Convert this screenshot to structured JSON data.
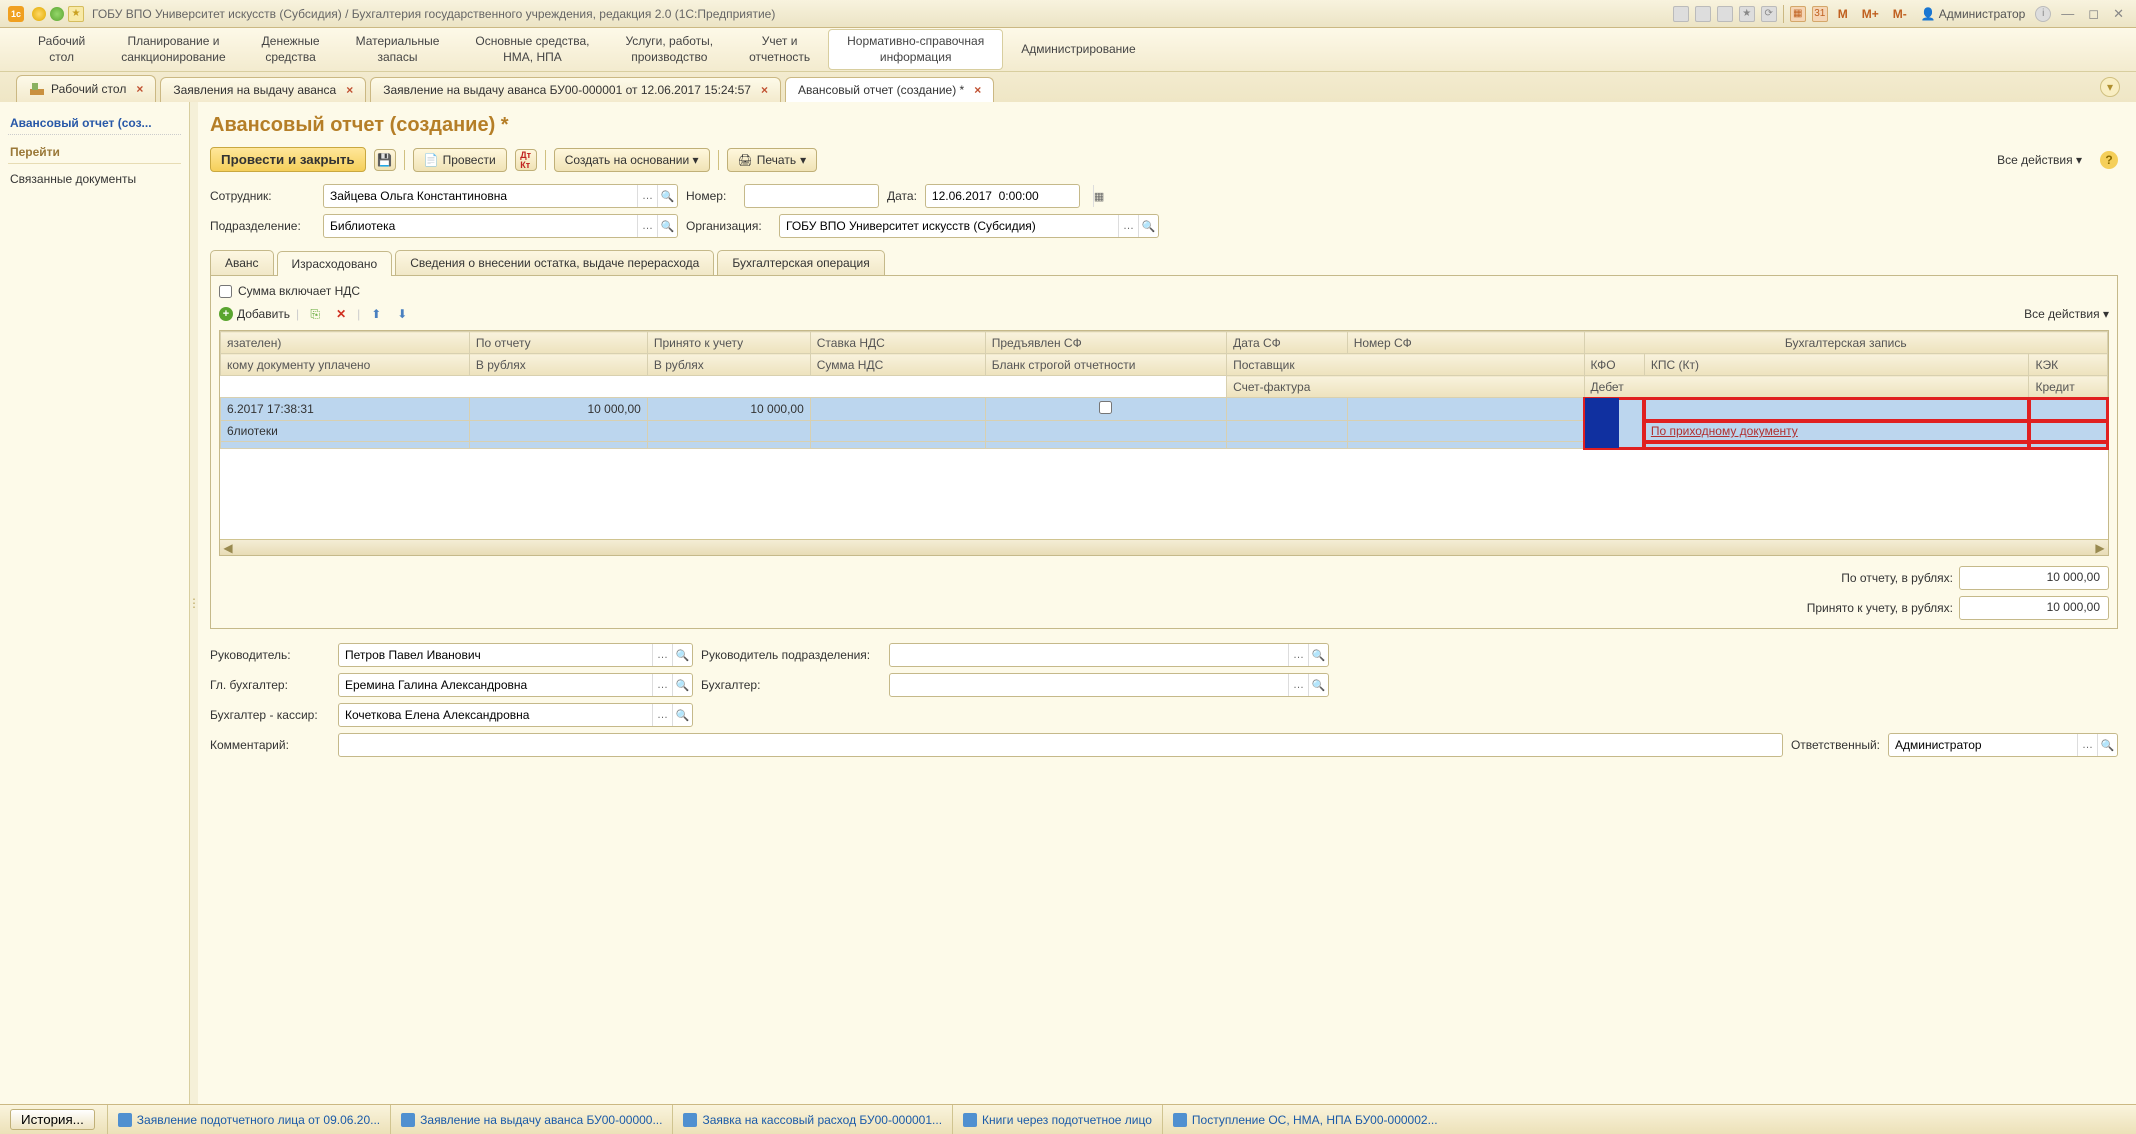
{
  "titlebar": {
    "title": "ГОБУ ВПО Университет искусств (Субсидия) / Бухгалтерия государственного учреждения, редакция 2.0  (1С:Предприятие)",
    "m": "M",
    "mplus": "M+",
    "mminus": "M-",
    "user": "Администратор"
  },
  "mainmenu": [
    "Рабочий\nстол",
    "Планирование и\nсанкционирование",
    "Денежные\nсредства",
    "Материальные\nзапасы",
    "Основные средства,\nНМА, НПА",
    "Услуги, работы,\nпроизводство",
    "Учет и\nотчетность",
    "Нормативно-справочная\nинформация",
    "Администрирование"
  ],
  "doctabs": [
    {
      "label": "Рабочий стол"
    },
    {
      "label": "Заявления на выдачу аванса"
    },
    {
      "label": "Заявление на выдачу аванса БУ00-000001 от 12.06.2017 15:24:57"
    },
    {
      "label": "Авансовый отчет (создание) *",
      "active": true
    }
  ],
  "sidebar": {
    "header": "Авансовый отчет (соз...",
    "group": "Перейти",
    "link1": "Связанные документы"
  },
  "page_title": "Авансовый отчет (создание) *",
  "toolbar": {
    "post_close": "Провести и закрыть",
    "post": "Провести",
    "create_based": "Создать на основании",
    "print": "Печать",
    "all_actions": "Все действия"
  },
  "form": {
    "employee_lbl": "Сотрудник:",
    "employee_val": "Зайцева Ольга Константиновна",
    "number_lbl": "Номер:",
    "number_val": "",
    "date_lbl": "Дата:",
    "date_val": "12.06.2017  0:00:00",
    "dept_lbl": "Подразделение:",
    "dept_val": "Библиотека",
    "org_lbl": "Организация:",
    "org_val": "ГОБУ ВПО Университет искусств (Субсидия)"
  },
  "subtabs": [
    "Аванс",
    "Израсходовано",
    "Сведения о внесении остатка, выдаче перерасхода",
    "Бухгалтерская операция"
  ],
  "subtab_active": 1,
  "vat_checkbox": "Сумма включает НДС",
  "grid_tb": {
    "add": "Добавить",
    "all_actions": "Все действия"
  },
  "grid_headers": {
    "r1": [
      "язателен)",
      "По отчету",
      "Принято к учету",
      "Ставка НДС",
      "Предъявлен СФ",
      "Дата СФ",
      "Номер СФ",
      "Бухгалтерская запись"
    ],
    "r2": [
      "кому документу уплачено",
      "В рублях",
      "В рублях",
      "Сумма НДС",
      "Бланк строгой отчетности",
      "Поставщик",
      "КФО",
      "КПС (Кт)",
      "КЭК"
    ],
    "r3": [
      "Счет-фактура",
      "Дебет",
      "Кредит"
    ]
  },
  "grid_data": {
    "r1_c1": "6.2017 17:38:31",
    "r1_c2": "10 000,00",
    "r1_c3": "10 000,00",
    "r2_c1": "6лиотеки",
    "link": "По приходному документу"
  },
  "totals": {
    "by_report_lbl": "По отчету, в рублях:",
    "by_report_val": "10 000,00",
    "accepted_lbl": "Принято к учету, в рублях:",
    "accepted_val": "10 000,00"
  },
  "footer": {
    "head_lbl": "Руководитель:",
    "head_val": "Петров Павел Иванович",
    "head_dept_lbl": "Руководитель подразделения:",
    "chief_acc_lbl": "Гл. бухгалтер:",
    "chief_acc_val": "Еремина Галина Александровна",
    "acc_lbl": "Бухгалтер:",
    "cashier_lbl": "Бухгалтер - кассир:",
    "cashier_val": "Кочеткова Елена Александровна",
    "comment_lbl": "Комментарий:",
    "resp_lbl": "Ответственный:",
    "resp_val": "Администратор"
  },
  "statusbar": {
    "history": "История...",
    "items": [
      "Заявление подотчетного лица от 09.06.20...",
      "Заявление на выдачу аванса БУ00-00000...",
      "Заявка на кассовый расход БУ00-000001...",
      "Книги через подотчетное лицо",
      "Поступление ОС, НМА, НПА БУ00-000002..."
    ]
  }
}
